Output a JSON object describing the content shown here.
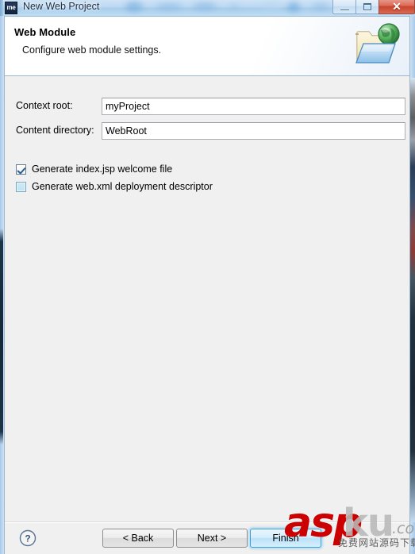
{
  "window": {
    "title": "New Web Project",
    "app_icon_text": "me",
    "controls": {
      "minimize_label": "Minimize",
      "maximize_label": "Maximize",
      "close_label": "Close",
      "close_glyph": "✕"
    }
  },
  "header": {
    "title": "Web Module",
    "subtitle": "Configure web module settings.",
    "icon_name": "web-folder-globe-icon"
  },
  "form": {
    "fields": [
      {
        "label": "Context root:",
        "value": "myProject",
        "placeholder": ""
      },
      {
        "label": "Content directory:",
        "value": "WebRoot",
        "placeholder": ""
      }
    ],
    "checkboxes": [
      {
        "label": "Generate index.jsp welcome file",
        "checked": true
      },
      {
        "label": "Generate web.xml deployment descriptor",
        "checked": false
      }
    ]
  },
  "footer": {
    "help_label": "?",
    "buttons": [
      {
        "label": "< Back",
        "default": false
      },
      {
        "label": "Next >",
        "default": false
      },
      {
        "label": "Finish",
        "default": true
      }
    ]
  },
  "watermark": {
    "part_red": "asp",
    "part_gray": "ku",
    "part_com": ".com",
    "chinese": "免费网站源码下载站"
  },
  "colors": {
    "accent_blue": "#3c9cd6",
    "title_glass": "#bcd9f2",
    "close_red": "#c8442c",
    "dialog_bg": "#f0f0f0",
    "watermark_red": "#cc0000"
  }
}
